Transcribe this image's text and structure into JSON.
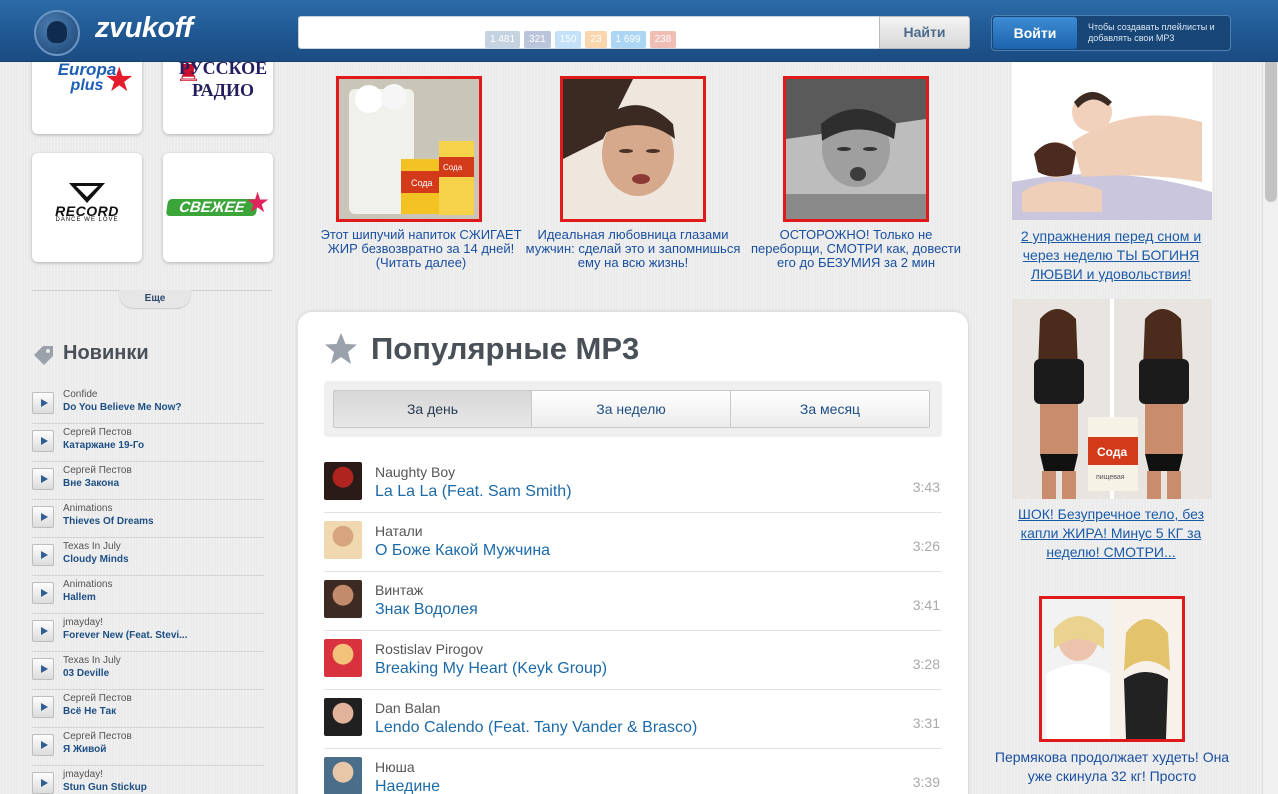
{
  "header": {
    "logo_text": "zvukoff",
    "search_placeholder": "",
    "search_button": "Найти",
    "share_counts": [
      "1 481",
      "321",
      "150",
      "23",
      "1 699",
      "238"
    ],
    "login_button": "Войти",
    "login_hint": "Чтобы создавать плейлисты и добавлять свои MP3"
  },
  "radio": {
    "europa_l1": "Europa",
    "europa_l2": "plus",
    "russkoe_l1": "РУССКОЕ",
    "russkoe_l2": "РАДИО",
    "record_l1": "RECORD",
    "record_l2": "DANCE WE LOVE",
    "svezhee_l1": "СВЕЖЕЕ",
    "more_label": "Еще"
  },
  "new_section": {
    "title": "Новинки",
    "items": [
      {
        "artist": "Confide",
        "title": "Do You Believe Me Now?"
      },
      {
        "artist": "Сергей Пестов",
        "title": "Катаржане 19-Го"
      },
      {
        "artist": "Сергей Пестов",
        "title": "Вне Закона"
      },
      {
        "artist": "Animations",
        "title": "Thieves Of Dreams"
      },
      {
        "artist": "Texas In July",
        "title": "Cloudy Minds"
      },
      {
        "artist": "Animations",
        "title": "Hallem"
      },
      {
        "artist": "jmayday!",
        "title": "Forever New (Feat. Stevi..."
      },
      {
        "artist": "Texas In July",
        "title": "03 Deville"
      },
      {
        "artist": "Сергей Пестов",
        "title": "Всё Не Так"
      },
      {
        "artist": "Сергей Пестов",
        "title": "Я Живой"
      },
      {
        "artist": "jmayday!",
        "title": "Stun Gun Stickup"
      }
    ]
  },
  "middle_ads": [
    {
      "text": "Этот шипучий напиток СЖИГАЕТ ЖИР безвозвратно за 14 дней! (Читать далее)"
    },
    {
      "text": "Идеальная любовница глазами мужчин: сделай это и запомнишься ему на всю жизнь!"
    },
    {
      "text": "ОСТОРОЖНО! Только не переборщи, СМОТРИ как, довести его до БЕЗУМИЯ за 2 мин"
    }
  ],
  "popular": {
    "title": "Популярные MP3",
    "tabs": [
      "За день",
      "За неделю",
      "За месяц"
    ],
    "tracks": [
      {
        "artist": "Naughty Boy",
        "title": "La La La (Feat. Sam Smith)",
        "duration": "3:43"
      },
      {
        "artist": "Натали",
        "title": "О Боже Какой Мужчина",
        "duration": "3:26"
      },
      {
        "artist": "Винтаж",
        "title": "Знак Водолея",
        "duration": "3:41"
      },
      {
        "artist": "Rostislav Pirogov",
        "title": "Breaking My Heart (Keyk Group)",
        "duration": "3:28"
      },
      {
        "artist": "Dan Balan",
        "title": "Lendo Calendo (Feat. Tany Vander & Brasco)",
        "duration": "3:31"
      },
      {
        "artist": "Нюша",
        "title": "Наедине",
        "duration": "3:39"
      }
    ]
  },
  "right_ads": [
    {
      "text": "2 упражнения перед сном и через неделю ТЫ БОГИНЯ ЛЮБВИ и удовольствия!"
    },
    {
      "text": "ШОК! Безупречное тело, без капли ЖИРА! Минус 5 КГ за неделю! СМОТРИ..."
    },
    {
      "text": "Пермякова продолжает худеть! Она уже скинула 32 кг! Просто"
    }
  ],
  "ad_image_labels": {
    "soda": "Сода",
    "soda_small": "пищевая"
  }
}
